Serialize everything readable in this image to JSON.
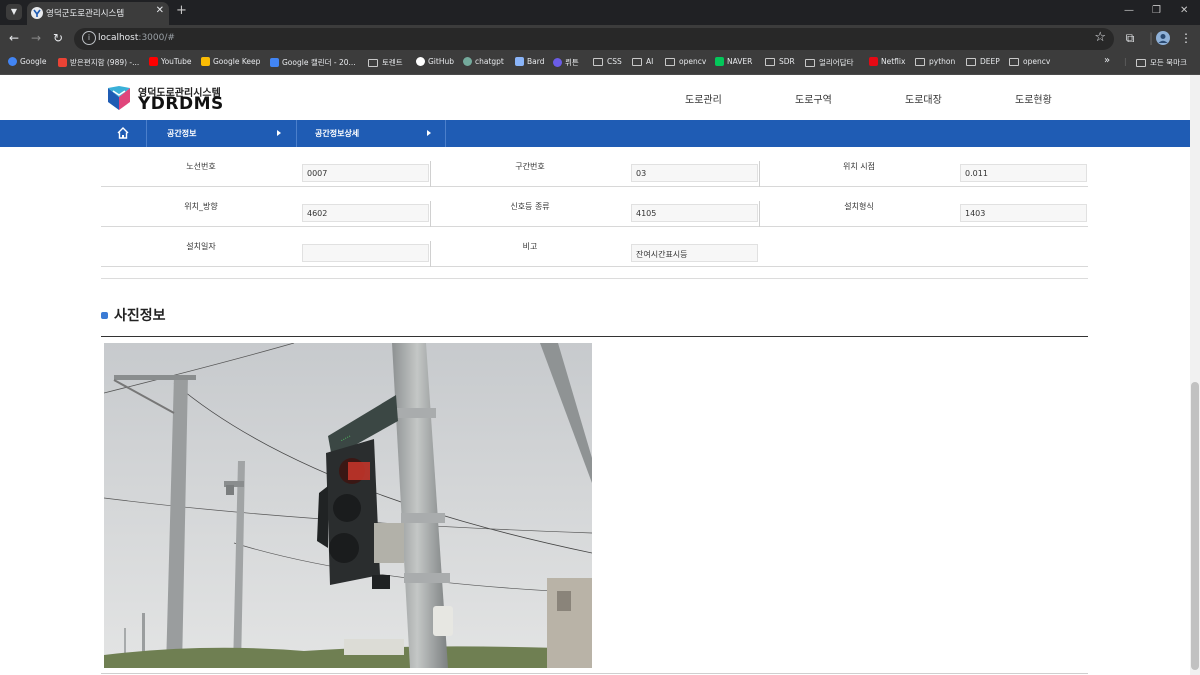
{
  "browser": {
    "tab_title": "영덕군도로관리시스템",
    "url_host": "localhost",
    "url_path": ":3000/#",
    "new_tab": "+",
    "close": "✕",
    "bookmarks": [
      {
        "label": "Google",
        "icon": "google-icon",
        "color": "#4285f4"
      },
      {
        "label": "받은편지함 (989) -...",
        "icon": "gmail-icon",
        "color": "#ea4335"
      },
      {
        "label": "YouTube",
        "icon": "youtube-icon",
        "color": "#ff0000"
      },
      {
        "label": "Google Keep",
        "icon": "keep-icon",
        "color": "#fbbc04"
      },
      {
        "label": "Google 캘린더 - 20...",
        "icon": "calendar-icon",
        "color": "#4285f4"
      },
      {
        "label": "토렌트",
        "icon": "folder-icon",
        "color": ""
      },
      {
        "label": "GitHub",
        "icon": "github-icon",
        "color": "#ffffff"
      },
      {
        "label": "chatgpt",
        "icon": "chatgpt-icon",
        "color": "#74aa9c"
      },
      {
        "label": "Bard",
        "icon": "bard-icon",
        "color": "#8ab4f8"
      },
      {
        "label": "뤼튼",
        "icon": "wrtn-icon",
        "color": "#6b5ce7"
      },
      {
        "label": "CSS",
        "icon": "folder-icon",
        "color": ""
      },
      {
        "label": "AI",
        "icon": "folder-icon",
        "color": ""
      },
      {
        "label": "opencv",
        "icon": "folder-icon",
        "color": ""
      },
      {
        "label": "NAVER",
        "icon": "naver-icon",
        "color": "#03c75a"
      },
      {
        "label": "SDR",
        "icon": "folder-icon",
        "color": ""
      },
      {
        "label": "얼리어답타",
        "icon": "folder-icon",
        "color": ""
      },
      {
        "label": "Netflix",
        "icon": "netflix-icon",
        "color": "#e50914"
      },
      {
        "label": "python",
        "icon": "folder-icon",
        "color": ""
      },
      {
        "label": "DEEP",
        "icon": "folder-icon",
        "color": ""
      },
      {
        "label": "opencv",
        "icon": "folder-icon",
        "color": ""
      }
    ],
    "more_bookmarks": "»",
    "all_bookmarks": "모든 북마크"
  },
  "site": {
    "logo_ko": "영덕도로관리시스템",
    "logo_en": "YDRDMS",
    "nav": [
      "도로관리",
      "도로구역",
      "도로대장",
      "도로현황"
    ],
    "breadcrumb": [
      "공간정보",
      "공간정보상세"
    ]
  },
  "details": {
    "rows": [
      [
        {
          "label": "노선번호",
          "value": "0007"
        },
        {
          "label": "구간번호",
          "value": "03"
        },
        {
          "label": "위치 시점",
          "value": "0.011"
        }
      ],
      [
        {
          "label": "위치_방향",
          "value": "4602"
        },
        {
          "label": "신호등 종류",
          "value": "4105"
        },
        {
          "label": "설치형식",
          "value": "1403"
        }
      ],
      [
        {
          "label": "설치일자",
          "value": ""
        },
        {
          "label": "비고",
          "value": "잔여시간표시등"
        }
      ]
    ]
  },
  "photo_section": {
    "title": "사진정보"
  },
  "colors": {
    "nav_bar": "#1f5cb4",
    "accent": "#3a7bd5"
  }
}
